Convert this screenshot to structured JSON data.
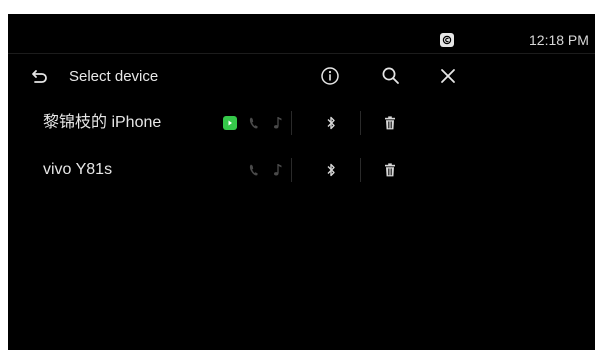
{
  "status_bar": {
    "time": "12:18 PM",
    "carplay_badge_icon": "carplay-c-icon"
  },
  "header": {
    "title": "Select device",
    "back_icon": "back-arrow-icon",
    "info_icon": "info-icon",
    "search_icon": "search-icon",
    "close_icon": "close-icon"
  },
  "devices": [
    {
      "name": "黎锦枝的 iPhone",
      "carplay_active": true,
      "icons": [
        "carplay-icon",
        "phone-icon",
        "music-icon",
        "bluetooth-icon",
        "delete-icon"
      ]
    },
    {
      "name": "vivo Y81s",
      "carplay_active": false,
      "icons": [
        "phone-icon",
        "music-icon",
        "bluetooth-icon",
        "delete-icon"
      ]
    }
  ],
  "colors": {
    "background": "#000000",
    "text": "#e6e6e6",
    "dim_icon": "#555555",
    "carplay_green": "#35c84a"
  }
}
